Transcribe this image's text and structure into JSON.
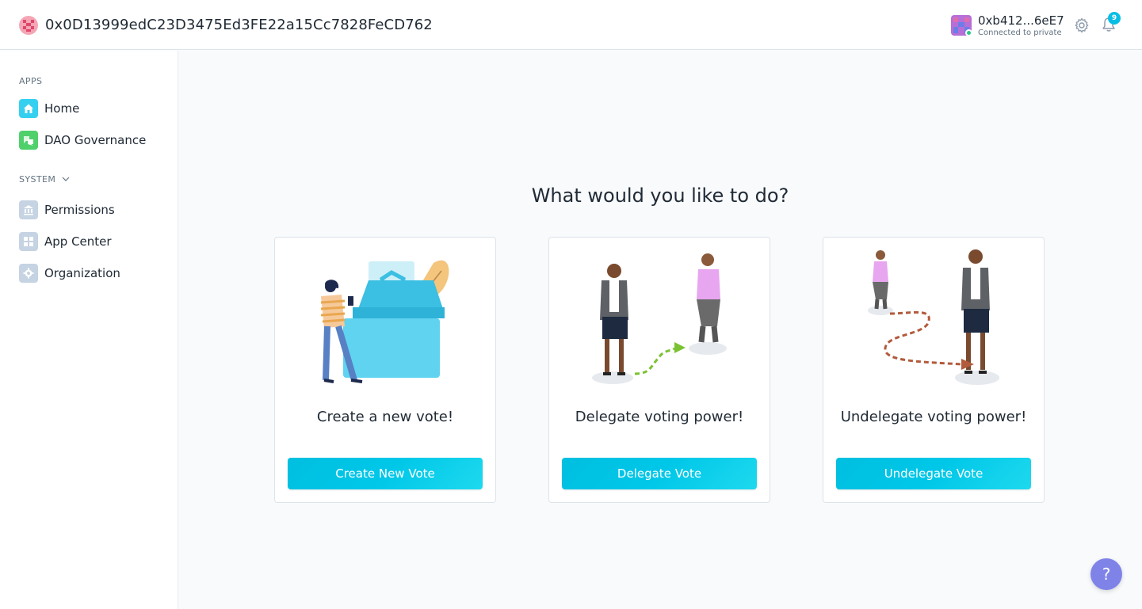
{
  "header": {
    "org_address": "0x0D13999edC23D3475Ed3FE22a15Cc7828FeCD762",
    "account_name": "0xb412...6eE7",
    "account_status": "Connected to private",
    "notification_count": "9"
  },
  "sidebar": {
    "apps_label": "APPS",
    "system_label": "SYSTEM",
    "apps": [
      {
        "label": "Home",
        "icon": "home-icon"
      },
      {
        "label": "DAO Governance",
        "icon": "voting-icon"
      }
    ],
    "system": [
      {
        "label": "Permissions",
        "icon": "bank-icon"
      },
      {
        "label": "App Center",
        "icon": "grid-icon"
      },
      {
        "label": "Organization",
        "icon": "gear-icon"
      }
    ]
  },
  "main": {
    "title": "What would you like to do?",
    "cards": [
      {
        "title": "Create a new vote!",
        "button": "Create New Vote"
      },
      {
        "title": "Delegate voting power!",
        "button": "Delegate Vote"
      },
      {
        "title": "Undelegate voting power!",
        "button": "Undelegate Vote"
      }
    ]
  },
  "help": {
    "label": "?"
  },
  "colors": {
    "accent": "#08bee5",
    "help": "#7f83e8",
    "connected": "#2cc68f"
  }
}
